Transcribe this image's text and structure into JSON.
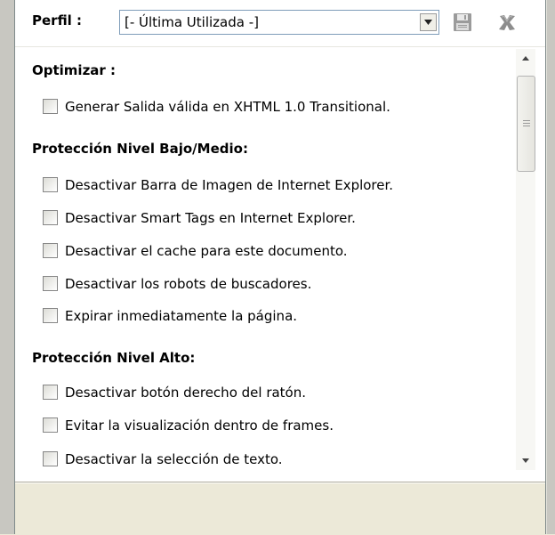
{
  "toolbar": {
    "perfil_label": "Perfil :",
    "profile_value": "[- Última Utilizada -]",
    "save_icon": "floppy-disk-icon",
    "delete_icon": "delete-x-icon"
  },
  "sections": [
    {
      "title": "Optimizar :",
      "options": [
        {
          "label": "Generar Salida válida en XHTML 1.0 Transitional.",
          "checked": false
        }
      ]
    },
    {
      "title": "Protección Nivel Bajo/Medio:",
      "options": [
        {
          "label": "Desactivar Barra de Imagen de Internet Explorer.",
          "checked": false
        },
        {
          "label": "Desactivar Smart Tags en Internet Explorer.",
          "checked": false
        },
        {
          "label": "Desactivar el cache para este documento.",
          "checked": false
        },
        {
          "label": "Desactivar los robots de buscadores.",
          "checked": false
        },
        {
          "label": "Expirar inmediatamente la página.",
          "checked": false
        }
      ]
    },
    {
      "title": "Protección Nivel Alto:",
      "options": [
        {
          "label": "Desactivar botón derecho del ratón.",
          "checked": false
        },
        {
          "label": "Evitar la visualización dentro de frames.",
          "checked": false
        },
        {
          "label": "Desactivar la selección de texto.",
          "checked": false
        }
      ]
    }
  ]
}
